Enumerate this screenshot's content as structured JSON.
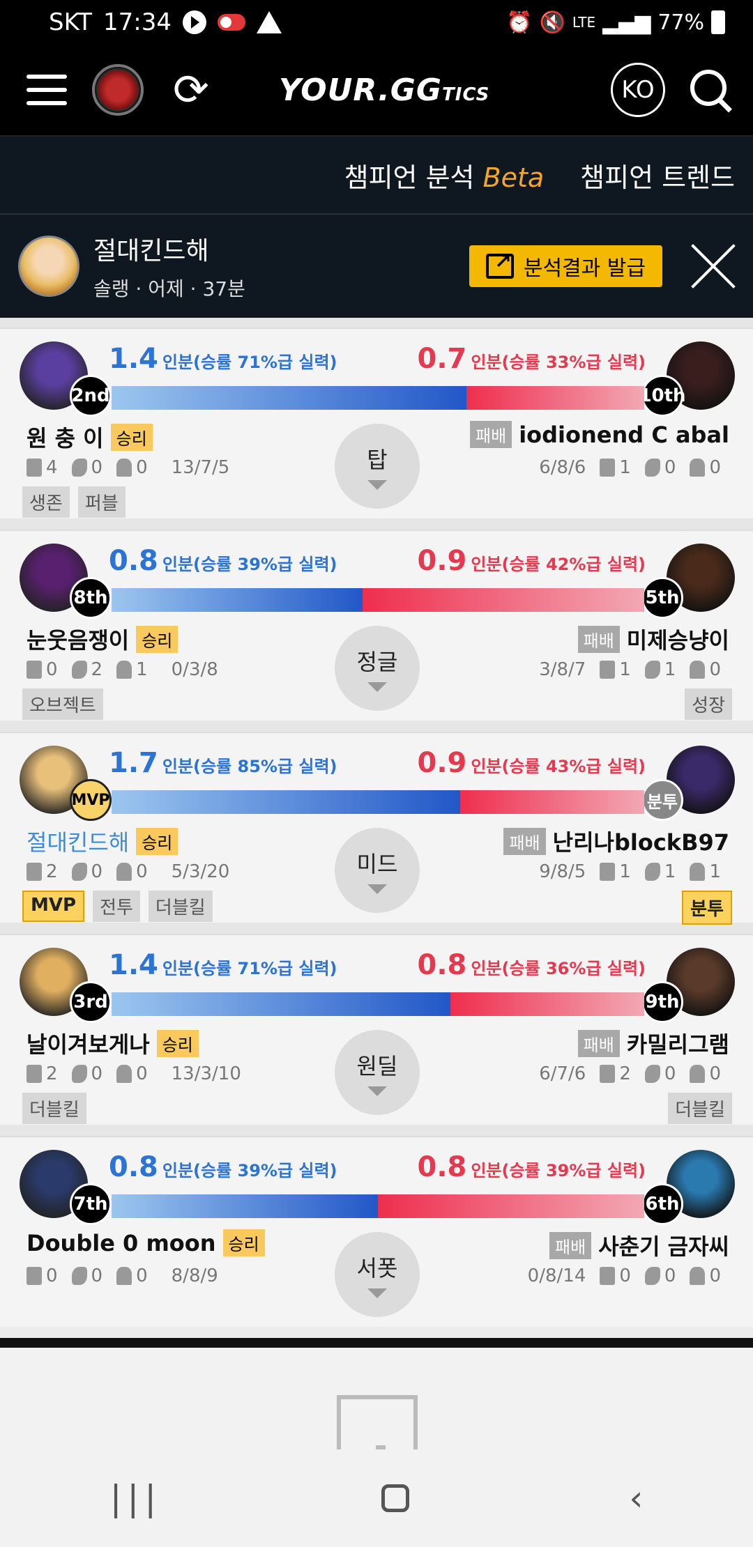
{
  "status": {
    "carrier": "SKT",
    "time": "17:34",
    "network": "LTE",
    "battery": "77%"
  },
  "header": {
    "brand": "YOUR.GG",
    "brand_suffix": "TICS",
    "lang": "KO"
  },
  "subnav": {
    "analysis": "챔피언 분석",
    "beta": "Beta",
    "trend": "챔피언 트렌드"
  },
  "champ": {
    "name": "절대킨드해",
    "meta": "솔랭 · 어제 · 37분",
    "share": "분석결과 발급"
  },
  "rows": [
    {
      "pos": "탑",
      "blue": {
        "val": "1.4",
        "desc": "인분(승률 71%급 실력)",
        "rank": "2nd",
        "name": "원 충 이",
        "result": "승리",
        "towers": "4",
        "drakes": "0",
        "barons": "0",
        "kda": "13/7/5",
        "tags": [
          "생존",
          "퍼블"
        ]
      },
      "red": {
        "val": "0.7",
        "desc": "인분(승률 33%급 실력)",
        "rank": "10th",
        "name": "iodionend C abal",
        "result": "패배",
        "towers": "1",
        "drakes": "0",
        "barons": "0",
        "kda": "6/8/6",
        "tags": []
      }
    },
    {
      "pos": "정글",
      "blue": {
        "val": "0.8",
        "desc": "인분(승률 39%급 실력)",
        "rank": "8th",
        "name": "눈웃음쟁이",
        "result": "승리",
        "towers": "0",
        "drakes": "2",
        "barons": "1",
        "kda": "0/3/8",
        "tags": [
          "오브젝트"
        ]
      },
      "red": {
        "val": "0.9",
        "desc": "인분(승률 42%급 실력)",
        "rank": "5th",
        "name": "미제승냥이",
        "result": "패배",
        "towers": "1",
        "drakes": "1",
        "barons": "0",
        "kda": "3/8/7",
        "tags": [
          "성장"
        ]
      }
    },
    {
      "pos": "미드",
      "blue": {
        "val": "1.7",
        "desc": "인분(승률 85%급 실력)",
        "rank": "MVP",
        "name": "절대킨드해",
        "result": "승리",
        "towers": "2",
        "drakes": "0",
        "barons": "0",
        "kda": "5/3/20",
        "tags": [
          "MVP",
          "전투",
          "더블킬"
        ]
      },
      "red": {
        "val": "0.9",
        "desc": "인분(승률 43%급 실력)",
        "rank": "분투",
        "name": "난리나blockB97",
        "result": "패배",
        "towers": "1",
        "drakes": "1",
        "barons": "1",
        "kda": "9/8/5",
        "tags": [
          "분투"
        ]
      }
    },
    {
      "pos": "원딜",
      "blue": {
        "val": "1.4",
        "desc": "인분(승률 71%급 실력)",
        "rank": "3rd",
        "name": "날이겨보게나",
        "result": "승리",
        "towers": "2",
        "drakes": "0",
        "barons": "0",
        "kda": "13/3/10",
        "tags": [
          "더블킬"
        ]
      },
      "red": {
        "val": "0.8",
        "desc": "인분(승률 36%급 실력)",
        "rank": "9th",
        "name": "카밀리그램",
        "result": "패배",
        "towers": "2",
        "drakes": "0",
        "barons": "0",
        "kda": "6/7/6",
        "tags": [
          "더블킬"
        ]
      }
    },
    {
      "pos": "서폿",
      "blue": {
        "val": "0.8",
        "desc": "인분(승률 39%급 실력)",
        "rank": "7th",
        "name": "Double 0 moon",
        "result": "승리",
        "towers": "0",
        "drakes": "0",
        "barons": "0",
        "kda": "8/8/9",
        "tags": []
      },
      "red": {
        "val": "0.8",
        "desc": "인분(승률 39%급 실력)",
        "rank": "6th",
        "name": "사춘기 금자씨",
        "result": "패배",
        "towers": "0",
        "drakes": "0",
        "barons": "0",
        "kda": "0/8/14",
        "tags": []
      }
    }
  ],
  "colors": {
    "blue": "#2b74d6",
    "red": "#e6394f",
    "gold": "#f5b800"
  }
}
